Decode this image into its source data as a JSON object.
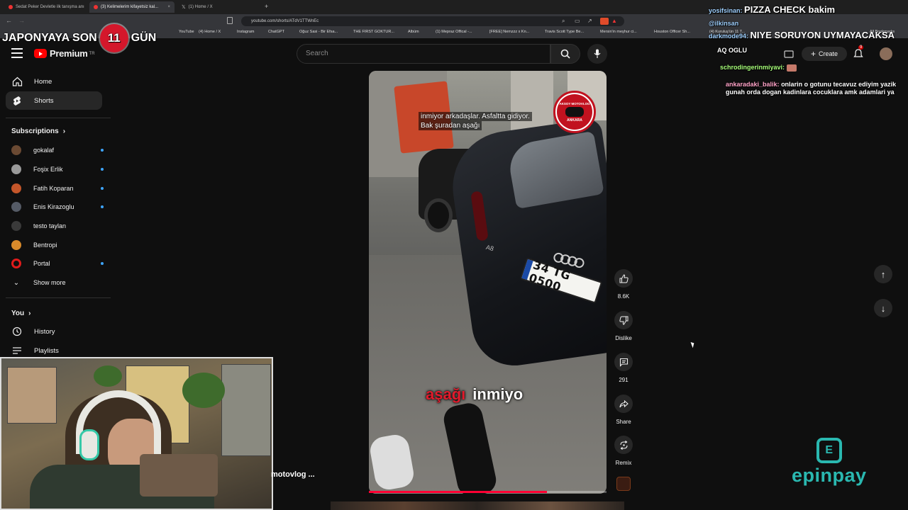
{
  "browser": {
    "tabs": [
      {
        "title": "Sedat Peker Devletle ilk tanışma anı"
      },
      {
        "title": "(3) Kelimelerim kifayetsiz kal..."
      },
      {
        "title": "(1) Home / X"
      }
    ],
    "url": "youtube.com/shorts/ATdV1TTWnEc",
    "bookmarks": [
      "YouTube",
      "(4) Home / X",
      "Instagram",
      "ChatGPT",
      "Oğuz Sasi - Bir Efsa...",
      "THE FIRST GOKTUR...",
      "Albüm",
      "(1) Mepraz Offical -...",
      "[FREE] Nemzzz x Kn...",
      "Travis Scott Type Be...",
      "Mersin'in meşhur ci...",
      "Houston Officer Sh...",
      "(4) Kuruluş'ün 11 T..."
    ],
    "bookmarks_right": "All Bookmarks"
  },
  "header": {
    "logo_text": "Premium",
    "logo_region": "TR",
    "search_placeholder": "Search",
    "create_label": "Create",
    "notification_count": "9"
  },
  "sidebar": {
    "items": [
      {
        "label": "Home",
        "icon": "home-icon"
      },
      {
        "label": "Shorts",
        "icon": "shorts-icon"
      }
    ],
    "subscriptions_title": "Subscriptions",
    "subscriptions": [
      {
        "name": "gokalaf",
        "color": "#6b4a33"
      },
      {
        "name": "Foşix Erlik",
        "color": "#9a9a9a"
      },
      {
        "name": "Fatih Koparan",
        "color": "#c4562a"
      },
      {
        "name": "Enis Kirazoglu",
        "color": "#555b66"
      },
      {
        "name": "testo taylan",
        "color": "#3a3a3a"
      },
      {
        "name": "Bentropi",
        "color": "#d98a2b"
      },
      {
        "name": "Portal",
        "color": "#e01b1b"
      }
    ],
    "show_more": "Show more",
    "you_title": "You",
    "you_items": [
      {
        "label": "History",
        "icon": "history-icon"
      },
      {
        "label": "Playlists",
        "icon": "playlists-icon"
      }
    ]
  },
  "short": {
    "caption_lines": [
      "inmiyor arkadaşlar. Asfaltta gidiyor.",
      "Bak şuradan aşağı"
    ],
    "badge_top": "AKSOY MOTOVLOG",
    "badge_bottom": "ANKARA",
    "plate": "34 TG 0500",
    "car_model": "A8",
    "subtitle_red": "aşağı",
    "subtitle_white": "inmiyo",
    "progress": 0.75,
    "channel_label": "motovlog ..."
  },
  "actions": {
    "like_count": "8.6K",
    "dislike_label": "Dislike",
    "comment_count": "291",
    "share_label": "Share",
    "remix_label": "Remix"
  },
  "overlay": {
    "banner_pre": "JAPONYAYA SON",
    "banner_num": "11",
    "banner_post": "GÜN",
    "chat": [
      {
        "user": "yosifsinan:",
        "msg": "PIZZA CHECK bakim"
      },
      {
        "user": "@ilkinsan",
        "msg": ""
      },
      {
        "user": "darkmode94:",
        "msg": "NIYE SORUYON UYMAYACAKSA"
      },
      {
        "user": "",
        "msg": "AQ OGLU"
      },
      {
        "user": "schrodingerinmiyavi:",
        "msg": ""
      },
      {
        "user": "ankaradaki_balik:",
        "msg": "onlarin o gotunu tecavuz ediyim yazik gunah orda dogan kadinlara cocuklara amk adamlari ya"
      }
    ],
    "sponsor": "epinpay",
    "sponsor_color": "#2ab8b0"
  }
}
